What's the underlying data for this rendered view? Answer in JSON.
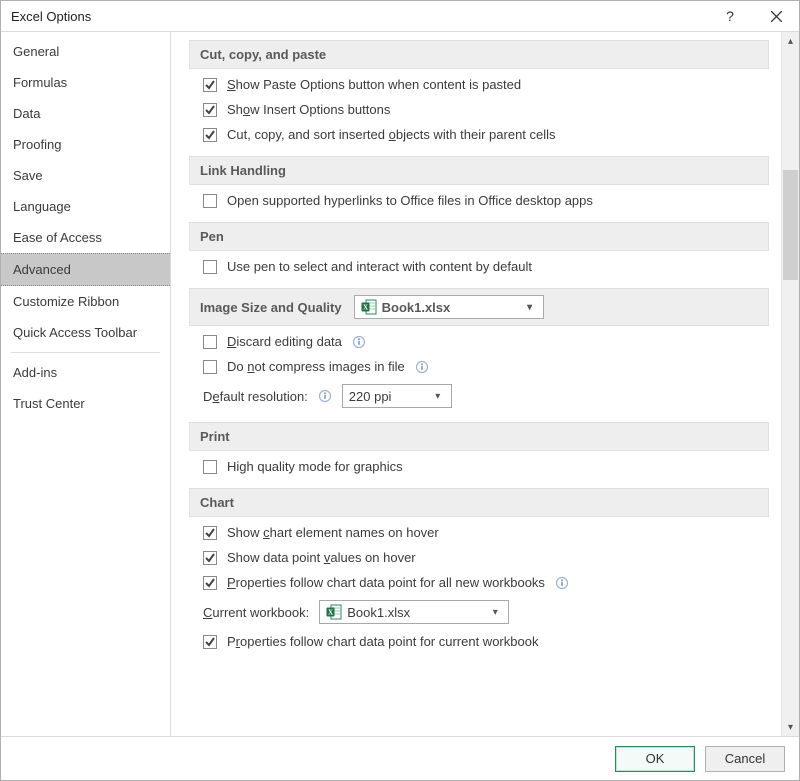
{
  "window": {
    "title": "Excel Options"
  },
  "sidebar": {
    "items": [
      "General",
      "Formulas",
      "Data",
      "Proofing",
      "Save",
      "Language",
      "Ease of Access",
      "Advanced",
      "Customize Ribbon",
      "Quick Access Toolbar",
      "Add-ins",
      "Trust Center"
    ],
    "selected": "Advanced"
  },
  "sections": {
    "cutCopyPaste": {
      "title": "Cut, copy, and paste",
      "showPasteOptions": {
        "checked": true,
        "label_pre": "",
        "u": "S",
        "label_post": "how Paste Options button when content is pasted"
      },
      "showInsertOptions": {
        "checked": true,
        "label_pre": "Sh",
        "u": "o",
        "label_post": "w Insert Options buttons"
      },
      "cutCopySortObjects": {
        "checked": true,
        "label_pre": "Cut, copy, and sort inserted ",
        "u": "o",
        "label_post": "bjects with their parent cells"
      }
    },
    "linkHandling": {
      "title": "Link Handling",
      "openHyperlinks": {
        "checked": false,
        "label": "Open supported hyperlinks to Office files in Office desktop apps"
      }
    },
    "pen": {
      "title": "Pen",
      "usePen": {
        "checked": false,
        "label": "Use pen to select and interact with content by default"
      }
    },
    "imageQuality": {
      "title": "Image Size and Quality",
      "workbook": "Book1.xlsx",
      "discardEditing": {
        "checked": false,
        "label_pre": "",
        "u": "D",
        "label_post": "iscard editing data"
      },
      "doNotCompress": {
        "checked": false,
        "label_pre": "Do ",
        "u": "n",
        "label_post": "ot compress images in file"
      },
      "defaultResolution": {
        "label_pre": "D",
        "u": "e",
        "label_post": "fault resolution:",
        "value": "220 ppi"
      }
    },
    "print": {
      "title": "Print",
      "highQuality": {
        "checked": false,
        "label": "High quality mode for graphics"
      }
    },
    "chart": {
      "title": "Chart",
      "showElementNames": {
        "checked": true,
        "label_pre": "Show ",
        "u": "c",
        "label_post": "hart element names on hover"
      },
      "showDataPointValues": {
        "checked": true,
        "label_pre": "Show data point ",
        "u": "v",
        "label_post": "alues on hover"
      },
      "propertiesAllWorkbooks": {
        "checked": true,
        "label_pre": "",
        "u": "P",
        "label_post": "roperties follow chart data point for all new workbooks"
      },
      "currentWorkbook": {
        "label_pre": "",
        "u": "C",
        "label_post": "urrent workbook:",
        "value": "Book1.xlsx"
      },
      "propertiesCurrentWorkbook": {
        "checked": true,
        "label_pre": "P",
        "u": "r",
        "label_post": "operties follow chart data point for current workbook"
      }
    }
  },
  "footer": {
    "ok": "OK",
    "cancel": "Cancel"
  }
}
